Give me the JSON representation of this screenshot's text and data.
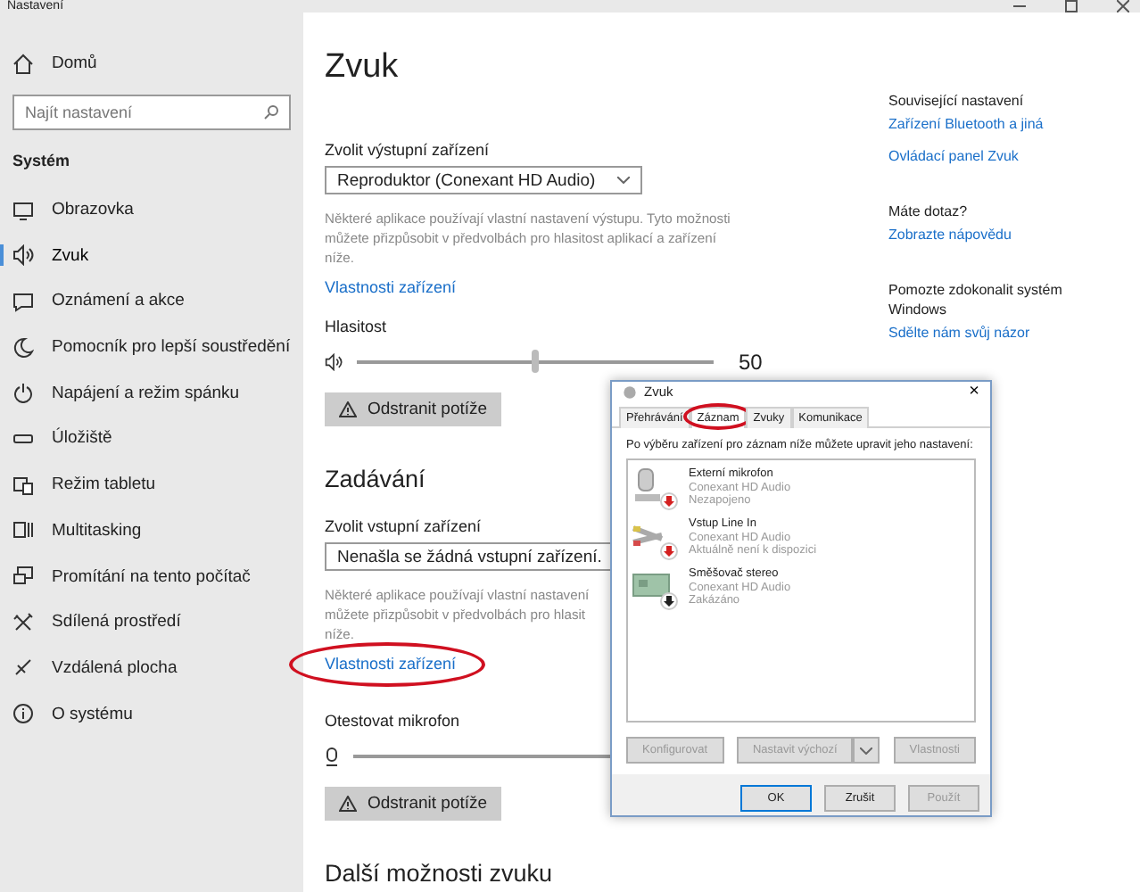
{
  "window": {
    "title": "Nastavení"
  },
  "sidebar": {
    "home": "Domů",
    "search": {
      "placeholder": "Najít nastavení"
    },
    "section": "Systém",
    "items": [
      {
        "label": "Obrazovka",
        "selected": false
      },
      {
        "label": "Zvuk",
        "selected": true
      },
      {
        "label": "Oznámení a akce",
        "selected": false
      },
      {
        "label": "Pomocník pro lepší soustředění",
        "selected": false
      },
      {
        "label": "Napájení a režim spánku",
        "selected": false
      },
      {
        "label": "Úložiště",
        "selected": false
      },
      {
        "label": "Režim tabletu",
        "selected": false
      },
      {
        "label": "Multitasking",
        "selected": false
      },
      {
        "label": "Promítání na tento počítač",
        "selected": false
      },
      {
        "label": "Sdílená prostředí",
        "selected": false
      },
      {
        "label": "Vzdálená plocha",
        "selected": false
      },
      {
        "label": "O systému",
        "selected": false
      }
    ]
  },
  "main": {
    "title": "Zvuk",
    "output": {
      "label": "Zvolit výstupní zařízení",
      "device": "Reproduktor (Conexant HD Audio)",
      "note_lines": [
        "Některé aplikace používají vlastní nastavení výstupu. Tyto možnosti",
        "můžete přizpůsobit v předvolbách pro hlasitost aplikací a zařízení",
        "níže."
      ],
      "link": "Vlastnosti zařízení",
      "volume_label": "Hlasitost",
      "volume": {
        "level": 0.5
      },
      "volume_reading": "50",
      "troubleshoot": "Odstranit potíže"
    },
    "input": {
      "heading": "Zadávání",
      "label": "Zvolit vstupní zařízení",
      "device": "Nenašla se žádná vstupní zařízení.",
      "note_lines": [
        "Některé aplikace používají vlastní nastavení",
        "můžete přizpůsobit v předvolbách pro hlasit",
        "níže."
      ],
      "link": "Vlastnosti zařízení",
      "link_circled": true,
      "test_label": "Otestovat mikrofon",
      "troubleshoot": "Odstranit potíže"
    },
    "more_heading": "Další možnosti zvuku"
  },
  "related": [
    {
      "heading": "Související nastavení",
      "links": [
        "Zařízení Bluetooth a jiná",
        "Ovládací panel Zvuk"
      ]
    },
    {
      "heading": "Máte dotaz?",
      "links": [
        "Zobrazte nápovědu"
      ]
    },
    {
      "heading": "Pomozte zdokonalit systém Windows",
      "links": [
        "Sdělte nám svůj názor"
      ]
    }
  ],
  "dialog": {
    "title": "Zvuk",
    "close": "×",
    "tabs": [
      {
        "label": "Přehrávání",
        "selected": false,
        "circled": false
      },
      {
        "label": "Záznam",
        "selected": true,
        "circled": true
      },
      {
        "label": "Zvuky",
        "selected": false,
        "circled": false
      },
      {
        "label": "Komunikace",
        "selected": false,
        "circled": false
      }
    ],
    "instruction": "Po výběru zařízení pro záznam níže můžete upravit jeho nastavení:",
    "devices": [
      {
        "name": "Externí mikrofon",
        "driver": "Conexant HD Audio",
        "status": "Nezapojeno",
        "kind": "microphone",
        "color": "#d42020"
      },
      {
        "name": "Vstup Line In",
        "driver": "Conexant HD Audio",
        "status": "Aktuálně není k dispozici",
        "kind": "cable",
        "color": "#d42020"
      },
      {
        "name": "Směšovač stereo",
        "driver": "Conexant HD Audio",
        "status": "Zakázáno",
        "kind": "board",
        "color": "#202020"
      }
    ],
    "buttons": [
      {
        "label": "Konfigurovat",
        "disabled": true,
        "kind": "plain"
      },
      {
        "label": "Nastavit výchozí",
        "disabled": true,
        "kind": "split"
      },
      {
        "label": "Vlastnosti",
        "disabled": true,
        "kind": "plain"
      }
    ],
    "footer": [
      {
        "label": "OK",
        "disabled": false,
        "default": true
      },
      {
        "label": "Zrušit",
        "disabled": false,
        "default": false
      },
      {
        "label": "Použít",
        "disabled": true,
        "default": false
      }
    ]
  }
}
